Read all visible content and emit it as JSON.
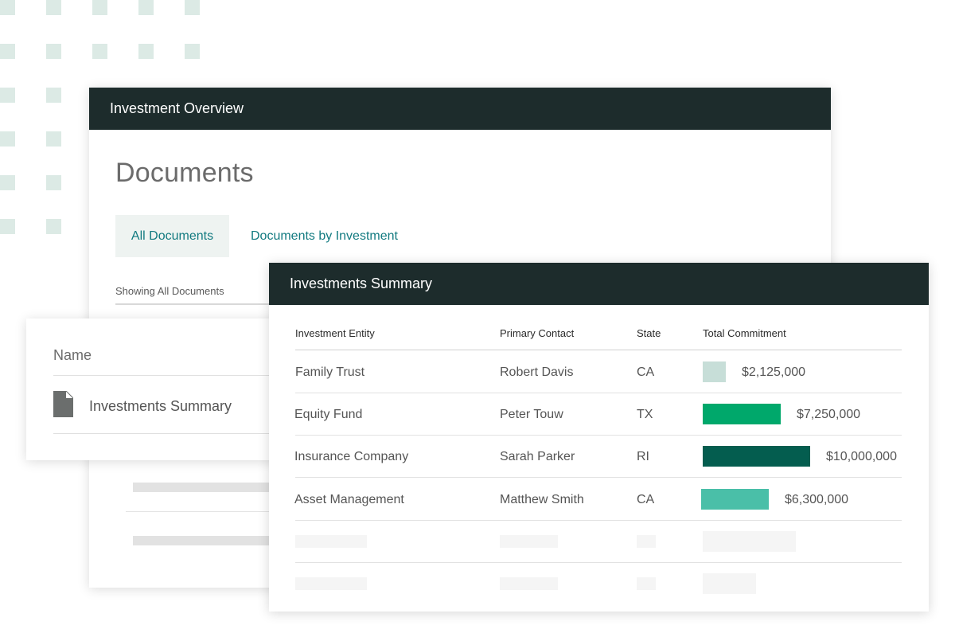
{
  "overview": {
    "header_title": "Investment Overview",
    "page_title": "Documents",
    "tabs": [
      {
        "label": "All Documents",
        "active": true
      },
      {
        "label": "Documents by Investment",
        "active": false
      }
    ],
    "showing_text": "Showing All Documents"
  },
  "name_card": {
    "column_header": "Name",
    "file_name": "Investments Summary",
    "icon": "file-icon"
  },
  "summary": {
    "header_title": "Investments Summary",
    "columns": [
      "Investment Entity",
      "Primary Contact",
      "State",
      "Total Commitment"
    ],
    "rows": [
      {
        "entity": "Family Trust",
        "contact": "Robert Davis",
        "state": "CA",
        "commitment": "$2,125,000",
        "commitment_value": 2125000,
        "bar_color": "#c7ded8"
      },
      {
        "entity": "Equity Fund",
        "contact": "Peter Touw",
        "state": "TX",
        "commitment": "$7,250,000",
        "commitment_value": 7250000,
        "bar_color": "#00a86b"
      },
      {
        "entity": "Insurance Company",
        "contact": "Sarah Parker",
        "state": "RI",
        "commitment": "$10,000,000",
        "commitment_value": 10000000,
        "bar_color": "#045d4f"
      },
      {
        "entity": "Asset Management",
        "contact": "Matthew Smith",
        "state": "CA",
        "commitment": "$6,300,000",
        "commitment_value": 6300000,
        "bar_color": "#4abfa8"
      }
    ]
  },
  "colors": {
    "header_bg": "#1d2c2c",
    "link": "#127a80",
    "dot_pattern": "#dceae5"
  }
}
